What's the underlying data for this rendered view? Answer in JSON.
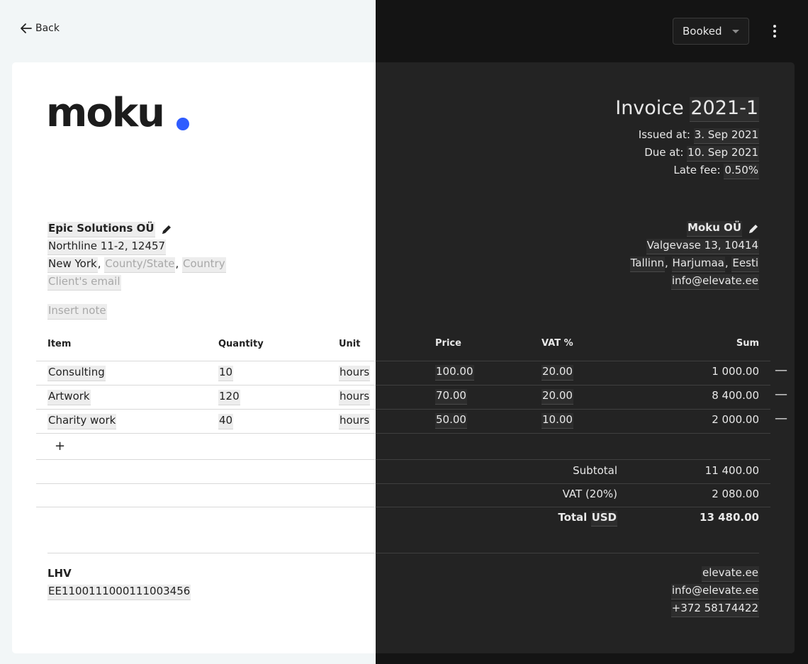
{
  "nav": {
    "back_label": "Back"
  },
  "status": {
    "selected": "Booked"
  },
  "colors": {
    "accent": "#2f5cff",
    "left_bg": "#ffffff",
    "right_bg": "#232323"
  },
  "logo": {
    "text": "moku"
  },
  "invoice": {
    "title_prefix": "Invoice",
    "number": "2021-1",
    "issued_label": "Issued at:",
    "issued_value": "3. Sep 2021",
    "due_label": "Due at:",
    "due_value": "10. Sep 2021",
    "late_fee_label": "Late fee:",
    "late_fee_value": "0.50%"
  },
  "client": {
    "name": "Epic Solutions OÜ",
    "address": "Northline 11-2, 12457",
    "city": "New York",
    "comma1": ",",
    "comma2": ",",
    "county_placeholder": "County/State",
    "country_placeholder": "Country",
    "email_placeholder": "Client's email",
    "note_placeholder": "Insert note"
  },
  "seller": {
    "name": "Moku OÜ",
    "address": "Valgevase 13, 10414",
    "city": "Tallinn",
    "county": "Harjumaa",
    "country": "Eesti",
    "comma1": ",",
    "comma2": ",",
    "email": "info@elevate.ee"
  },
  "table": {
    "headers": {
      "item": "Item",
      "quantity": "Quantity",
      "unit": "Unit",
      "price": "Price",
      "vat": "VAT %",
      "sum": "Sum"
    },
    "rows": [
      {
        "item": "Consulting",
        "quantity": "10",
        "unit": "hours",
        "price": "100.00",
        "vat": "20.00",
        "sum": "1 000.00"
      },
      {
        "item": "Artwork",
        "quantity": "120",
        "unit": "hours",
        "price": "70.00",
        "vat": "20.00",
        "sum": "8 400.00"
      },
      {
        "item": "Charity work",
        "quantity": "40",
        "unit": "hours",
        "price": "50.00",
        "vat": "10.00",
        "sum": "2 000.00"
      }
    ],
    "add_symbol": "+",
    "remove_symbol": "—"
  },
  "totals": {
    "subtotal_label": "Subtotal",
    "subtotal_value": "11 400.00",
    "vat_label": "VAT (20%)",
    "vat_value": "2 080.00",
    "total_label": "Total",
    "currency": "USD",
    "total_value": "13 480.00"
  },
  "footer": {
    "bank_name": "LHV",
    "iban": "EE1100111000111003456",
    "website": "elevate.ee",
    "email": "info@elevate.ee",
    "phone": "+372 58174422"
  }
}
